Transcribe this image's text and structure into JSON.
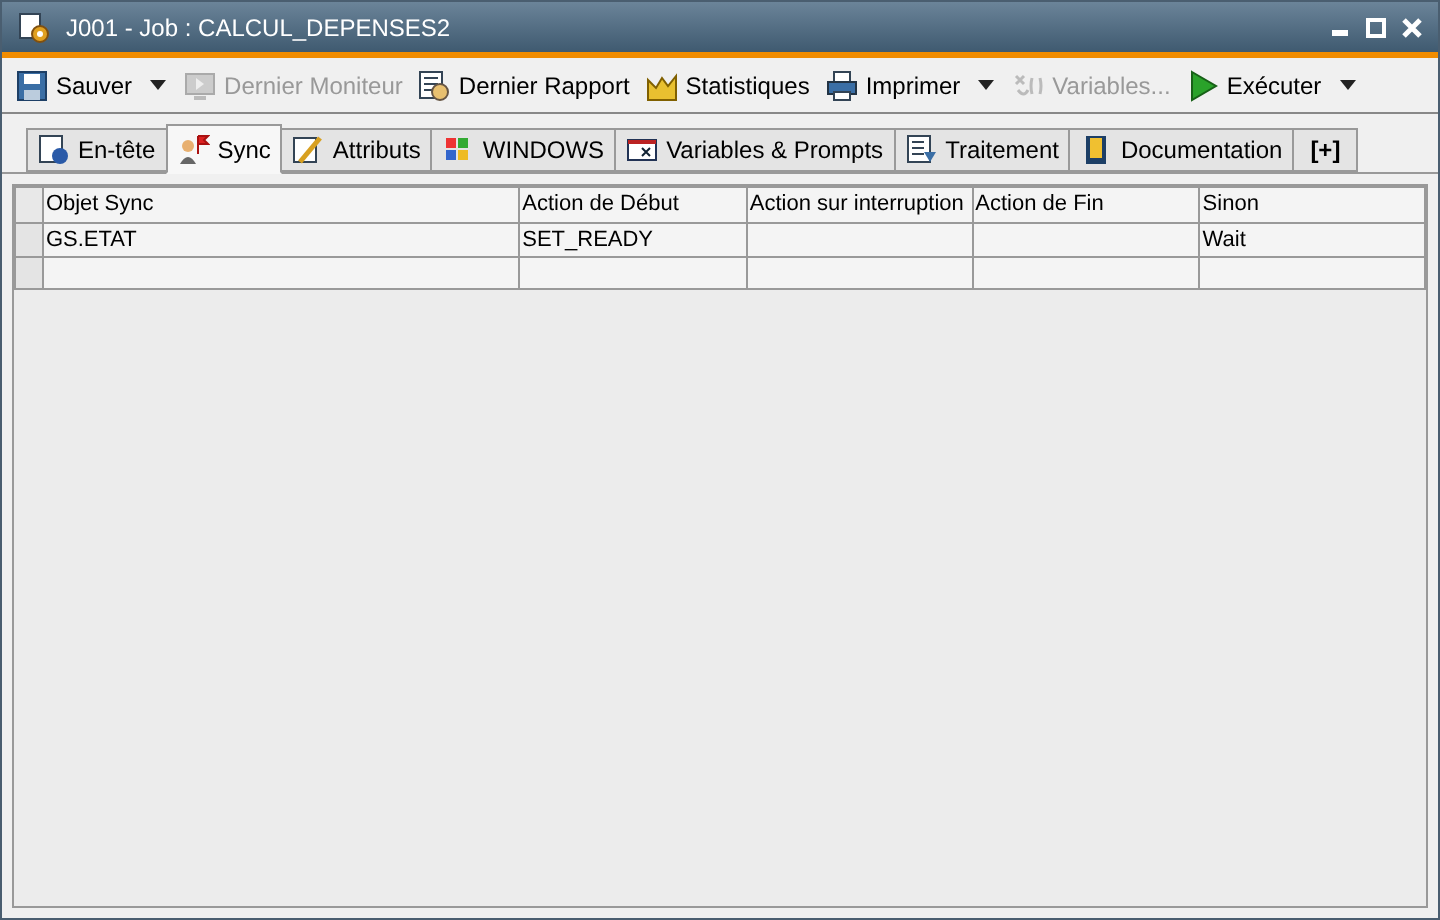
{
  "window": {
    "title": "J001 - Job : CALCUL_DEPENSES2"
  },
  "toolbar": [
    {
      "label": "Sauver",
      "kind": "save",
      "disabled": false,
      "dropdown": true
    },
    {
      "label": "Dernier Moniteur",
      "kind": "monitor",
      "disabled": true,
      "dropdown": false
    },
    {
      "label": "Dernier Rapport",
      "kind": "report",
      "disabled": false,
      "dropdown": false
    },
    {
      "label": "Statistiques",
      "kind": "stats",
      "disabled": false,
      "dropdown": false
    },
    {
      "label": "Imprimer",
      "kind": "print",
      "disabled": false,
      "dropdown": true
    },
    {
      "label": "Variables...",
      "kind": "variables",
      "disabled": true,
      "dropdown": false
    },
    {
      "label": "Exécuter",
      "kind": "run",
      "disabled": false,
      "dropdown": true
    }
  ],
  "tabs": [
    {
      "label": "En-tête",
      "kind": "header",
      "selected": false
    },
    {
      "label": "Sync",
      "kind": "sync",
      "selected": true
    },
    {
      "label": "Attributs",
      "kind": "attr",
      "selected": false
    },
    {
      "label": "WINDOWS",
      "kind": "windows",
      "selected": false
    },
    {
      "label": "Variables & Prompts",
      "kind": "vars",
      "selected": false
    },
    {
      "label": "Traitement",
      "kind": "proc",
      "selected": false
    },
    {
      "label": "Documentation",
      "kind": "doc",
      "selected": false
    },
    {
      "label": "[+]",
      "kind": "add",
      "selected": false
    }
  ],
  "table": {
    "columns": [
      "Objet Sync",
      "Action de Début",
      "Action sur interruption",
      "Action de Fin",
      "Sinon"
    ],
    "rows": [
      [
        "GS.ETAT",
        "SET_READY",
        "",
        "",
        "Wait"
      ],
      [
        "",
        "",
        "",
        "",
        ""
      ]
    ]
  }
}
